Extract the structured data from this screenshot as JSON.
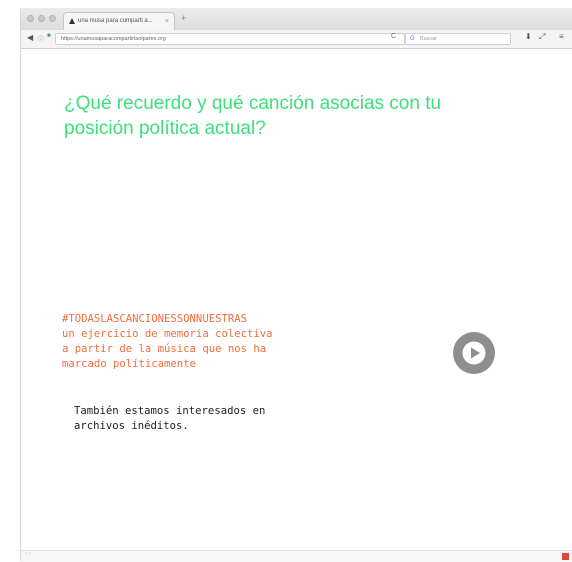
{
  "browser": {
    "tab_title": "una musa para comparti a...",
    "tab_close": "×",
    "new_tab": "+",
    "url": "https://unamusaparacompartirlaolpares.org",
    "reload": "C",
    "search_placeholder": "Buscar",
    "search_engine_glyph": "G",
    "back_glyph": "◀",
    "info_glyph": "ⓘ",
    "lock_glyph": "🔒",
    "download_glyph": "⬇",
    "resize_glyph": "⤢",
    "menu_glyph": "≡"
  },
  "page": {
    "question": "¿Qué recuerdo y qué canción asocias con tu posición política actual?",
    "hashtag_lines": [
      "#TODASLASCANCIONESSONNUESTRAS",
      "un ejercicio de memoria colectiva",
      "a partir de la música que nos ha",
      "marcado políticamente"
    ],
    "archives_lines": [
      "También estamos interesados en",
      "archivos inéditos."
    ]
  },
  "statusbar": {
    "nav_arrows": "‹ ›"
  },
  "colors": {
    "heading": "#3ee07a",
    "hashtag": "#f26d3d",
    "body_text": "#222222",
    "play_button": "#8e8e8e"
  }
}
